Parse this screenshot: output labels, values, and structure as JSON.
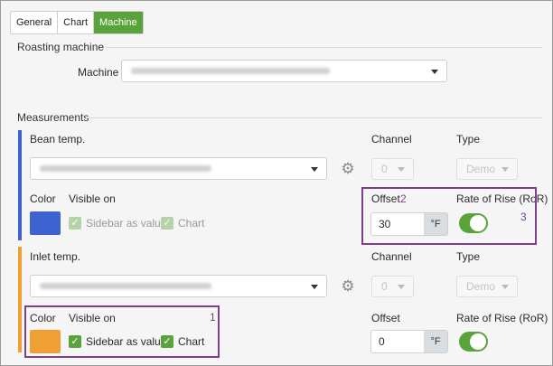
{
  "tabs": [
    {
      "label": "General",
      "active": false
    },
    {
      "label": "Chart",
      "active": false
    },
    {
      "label": "Machine",
      "active": true
    }
  ],
  "roasting_machine": {
    "section_title": "Roasting machine",
    "machine_label": "Machine",
    "machine_value_redacted": true
  },
  "measurements": {
    "section_title": "Measurements",
    "bean": {
      "label": "Bean temp.",
      "accent_color": "#3d63d0",
      "sensor_value_redacted": true,
      "channel_label": "Channel",
      "channel_value": "0",
      "type_label": "Type",
      "type_value": "Demo",
      "color_label": "Color",
      "color_value": "#3d63d0",
      "visible_on_label": "Visible on",
      "sidebar_label": "Sidebar as value",
      "sidebar_checked": true,
      "chart_label": "Chart",
      "chart_checked": true,
      "offset_label": "Offset",
      "offset_value": "30",
      "offset_unit": "°F",
      "ror_label": "Rate of Rise (RoR)",
      "ror_on": true
    },
    "inlet": {
      "label": "Inlet temp.",
      "accent_color": "#f0a033",
      "sensor_value_redacted": true,
      "channel_label": "Channel",
      "channel_value": "0",
      "type_label": "Type",
      "type_value": "Demo",
      "color_label": "Color",
      "color_value": "#f0a033",
      "visible_on_label": "Visible on",
      "sidebar_label": "Sidebar as value",
      "sidebar_checked": true,
      "chart_label": "Chart",
      "chart_checked": true,
      "offset_label": "Offset",
      "offset_value": "0",
      "offset_unit": "°F",
      "ror_label": "Rate of Rise (RoR)",
      "ror_on": true
    }
  },
  "annotations": {
    "one": "1",
    "two": "2",
    "three": "3",
    "color": "#7b3f8c"
  },
  "colors": {
    "accent_green": "#5aa33a"
  }
}
